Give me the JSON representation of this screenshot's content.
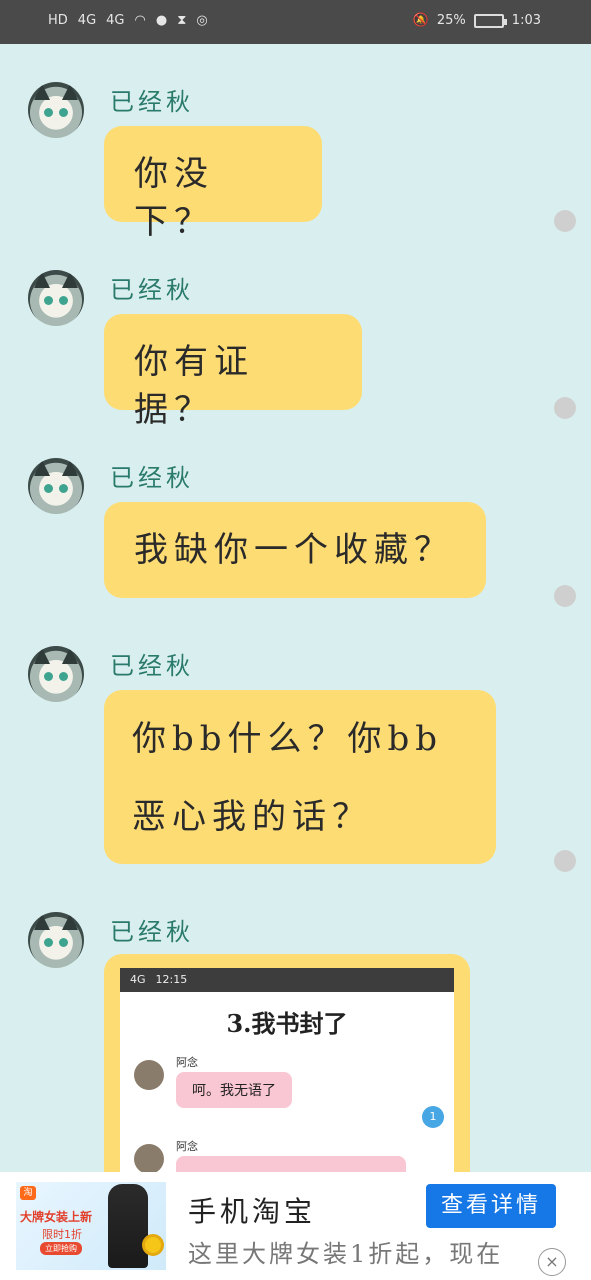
{
  "status_bar": {
    "hd": "HD",
    "net1": "4G",
    "net2": "4G",
    "battery_percent": "25%",
    "time": "1:03"
  },
  "messages": [
    {
      "sender": "已经秋",
      "text": "你没下？"
    },
    {
      "sender": "已经秋",
      "text": "你有证据？"
    },
    {
      "sender": "已经秋",
      "text": "我缺你一个收藏？"
    },
    {
      "sender": "已经秋",
      "text": "你bb什么？你bb恶心我的话？"
    },
    {
      "sender": "已经秋"
    }
  ],
  "embedded_screenshot": {
    "status_net": "4G",
    "time": "12:15",
    "title": "3.我书封了",
    "rows": [
      {
        "name": "阿念",
        "text": "呵。我无语了"
      },
      {
        "name": "阿念"
      }
    ],
    "badge": "1"
  },
  "ad": {
    "logo": "淘",
    "image_headline": "大牌女装上新",
    "image_sub": "限时1折",
    "image_cta": "立即抢购",
    "title": "手机淘宝",
    "description": "这里大牌女装1折起，现在",
    "button": "查看详情",
    "close": "×"
  }
}
